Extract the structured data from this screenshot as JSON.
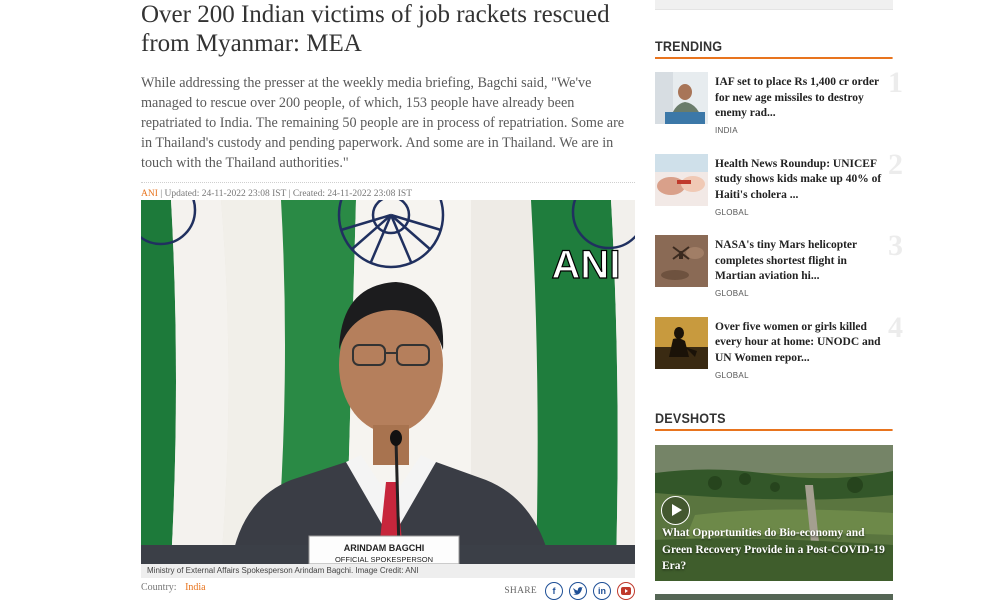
{
  "article": {
    "headline": "Over 200 Indian victims of job rackets rescued from Myanmar: MEA",
    "summary": "While addressing the presser at the weekly media briefing, Bagchi said, \"We've managed to rescue over 200 people, of which, 153 people have already been repatriated to India. The remaining 50 people are in process of repatriation. Some are in Thailand's custody and pending paperwork. And some are in Thailand. We are in touch with the Thailand authorities.\"",
    "source": "ANI",
    "updated": "| Updated: 24-11-2022 23:08 IST",
    "created": "| Created: 24-11-2022 23:08 IST",
    "image_watermark": "ANI",
    "nameplate_line1": "ARINDAM BAGCHI",
    "nameplate_line2": "OFFICIAL SPOKESPERSON",
    "caption": "Ministry of External Affairs Spokesperson Arindam Bagchi. Image Credit: ANI",
    "country_label": "Country:",
    "country_value": "India",
    "share_label": "SHARE",
    "share_icons": [
      "facebook-icon",
      "twitter-icon",
      "linkedin-icon",
      "youtube-icon"
    ]
  },
  "sidebar": {
    "trending_title": "TRENDING",
    "trending": [
      {
        "num": "1",
        "title": "IAF set to place Rs 1,400 cr order for new age missiles to destroy enemy rad...",
        "category": "INDIA"
      },
      {
        "num": "2",
        "title": "Health News Roundup: UNICEF study shows kids make up 40% of Haiti's cholera ...",
        "category": "GLOBAL"
      },
      {
        "num": "3",
        "title": "NASA's tiny Mars helicopter completes shortest flight in Martian aviation hi...",
        "category": "GLOBAL"
      },
      {
        "num": "4",
        "title": "Over five women or girls killed every hour at home: UNODC and UN Women repor...",
        "category": "GLOBAL"
      }
    ],
    "devshots_title": "DEVSHOTS",
    "devshot": {
      "title": "What Opportunities do Bio-economy and Green Recovery Provide in a Post-COVID-19 Era?"
    }
  },
  "colors": {
    "accent": "#e8741e",
    "social": "#1e4f96"
  }
}
